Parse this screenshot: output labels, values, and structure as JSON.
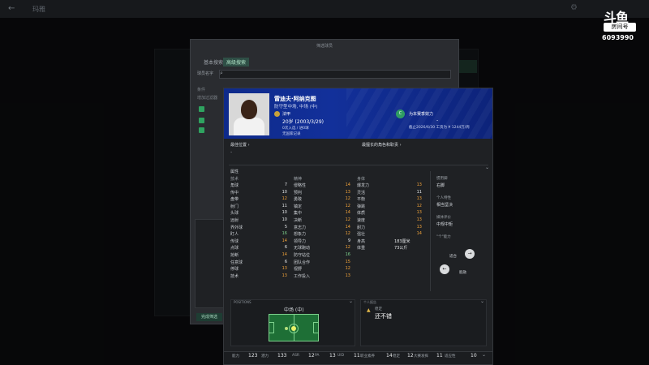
{
  "background": {
    "back_arrow": "←",
    "title": "玛雅",
    "dialog": {
      "title": "筛选球员",
      "tabs": [
        "基本搜索",
        "高级搜索"
      ],
      "name_label": "球员名字",
      "col_label": "条件",
      "filter_label": "增加过滤器",
      "confirm_button": "完成筛选"
    }
  },
  "player": {
    "name": "雷迪夫·阿纳克图",
    "position_line": "防守型中场, 中场 (中)",
    "club": "法甲",
    "age_line": "20岁 (2003/3/29)",
    "nationality": "0次入选 / 进0球",
    "intl": "无国家记录",
    "contract_club": "为本赛季效力",
    "contract_dash": "-",
    "contract_line": "截止2026/6/30 工资为 ¥ 1244万/周"
  },
  "sections": {
    "best_position_label": "最佳位置 ›",
    "best_position_value": "-",
    "best_role_label": "最擅长的角色和职责 ›",
    "attributes_title": "属性"
  },
  "attributes": {
    "headers": [
      "技术",
      "精神",
      "身体"
    ],
    "technical": [
      {
        "name": "角球",
        "value": "7"
      },
      {
        "name": "传中",
        "value": "10"
      },
      {
        "name": "盘带",
        "value": "12"
      },
      {
        "name": "射门",
        "value": "11"
      },
      {
        "name": "头球",
        "value": "10"
      },
      {
        "name": "远射",
        "value": "10"
      },
      {
        "name": "界外球",
        "value": "5"
      },
      {
        "name": "盯人",
        "value": "16"
      },
      {
        "name": "传球",
        "value": "14"
      },
      {
        "name": "点球",
        "value": "6"
      },
      {
        "name": "抢断",
        "value": "14"
      },
      {
        "name": "任意球",
        "value": "6"
      },
      {
        "name": "停球",
        "value": "13"
      },
      {
        "name": "技术",
        "value": "13"
      }
    ],
    "mental": [
      {
        "name": "侵略性",
        "value": "14"
      },
      {
        "name": "预判",
        "value": "13"
      },
      {
        "name": "勇敢",
        "value": "12"
      },
      {
        "name": "镇定",
        "value": "12"
      },
      {
        "name": "集中",
        "value": "14"
      },
      {
        "name": "决断",
        "value": "12"
      },
      {
        "name": "意志力",
        "value": "14"
      },
      {
        "name": "想象力",
        "value": "12"
      },
      {
        "name": "领导力",
        "value": "9"
      },
      {
        "name": "无球跑动",
        "value": "12"
      },
      {
        "name": "防守站位",
        "value": "16"
      },
      {
        "name": "团队合作",
        "value": "15"
      },
      {
        "name": "视野",
        "value": "12"
      },
      {
        "name": "工作投入",
        "value": "13"
      }
    ],
    "physical": [
      {
        "name": "爆发力",
        "value": "13"
      },
      {
        "name": "灵活",
        "value": "11"
      },
      {
        "name": "平衡",
        "value": "13"
      },
      {
        "name": "弹跳",
        "value": "12"
      },
      {
        "name": "体质",
        "value": "13"
      },
      {
        "name": "速度",
        "value": "13"
      },
      {
        "name": "耐力",
        "value": "13"
      },
      {
        "name": "强壮",
        "value": "14"
      }
    ],
    "physical_extra": [
      {
        "name": "身高",
        "value": "183厘米"
      },
      {
        "name": "体重",
        "value": "73公斤"
      }
    ]
  },
  "side_info": {
    "foot_label": "惯用脚",
    "foot_value": "右脚",
    "personality_label": "个人特性",
    "personality_value": "相当坚决",
    "media_label": "媒体评价",
    "media_value": "中规中矩",
    "ability_label": "\"个\"能力",
    "btn_left": "←",
    "btn_right": "→",
    "left_text": "适合",
    "right_text": "能融"
  },
  "position_panel": {
    "label": "POSITIONS",
    "title": "中场 (中)"
  },
  "report_panel": {
    "label": "个人报告",
    "sub": "稳定",
    "main": "还不错"
  },
  "bottom_bar": {
    "items": [
      {
        "label": "能力",
        "value": "123"
      },
      {
        "label": "潜力",
        "value": "133"
      },
      {
        "label": "ASR",
        "value": "12"
      },
      {
        "label": "PA",
        "value": "13"
      },
      {
        "label": "UID",
        "value": "11"
      },
      {
        "label": "职业素养",
        "value": "14"
      },
      {
        "label": "稳定",
        "value": "12"
      },
      {
        "label": "大赛发挥",
        "value": "11"
      },
      {
        "label": "适应性",
        "value": "10"
      }
    ]
  },
  "watermark": {
    "brand": "斗鱼",
    "room_label": "房间号",
    "room_number": "6093990"
  },
  "colors": {
    "header_blue": "#12309a",
    "value_orange": "#f0a23a",
    "value_white": "#e6e8ea",
    "value_green": "#7ed18d",
    "accent_green": "#2fa360"
  }
}
